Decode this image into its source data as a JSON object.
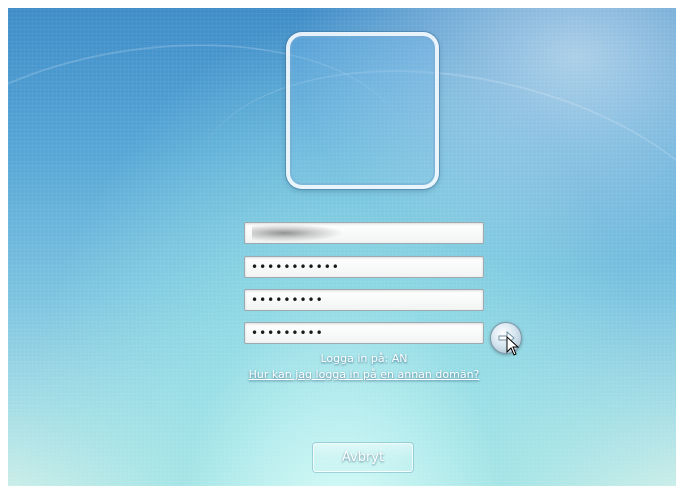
{
  "login": {
    "username_value": "",
    "password_value": "•••••••••••",
    "new_password_value": "•••••••••",
    "confirm_password_value": "•••••••••",
    "domain_text": "Logga in på: AN",
    "other_domain_link": "Hur kan jag logga in på en annan domän?",
    "cancel_label": "Avbryt"
  },
  "icons": {
    "user_picture": "user-picture-frame",
    "submit": "arrow-right-icon",
    "pointer": "mouse-pointer-icon"
  }
}
